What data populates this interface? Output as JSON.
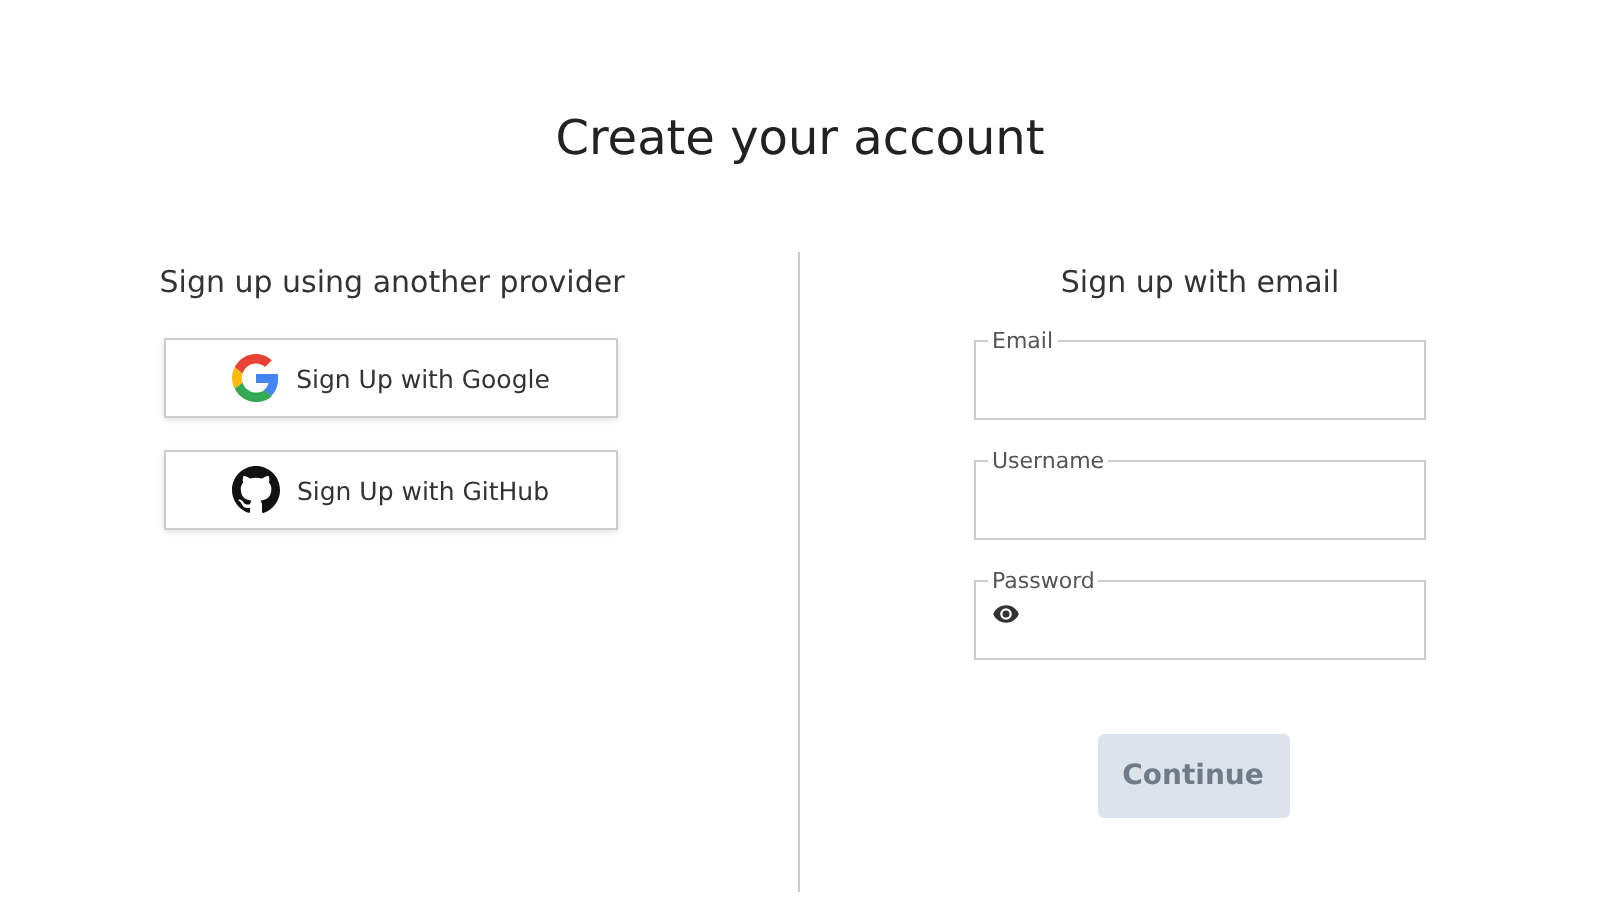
{
  "title": "Create your account",
  "providers": {
    "heading": "Sign up using another provider",
    "buttons": [
      {
        "kind": "google",
        "label": "Sign Up with Google"
      },
      {
        "kind": "github",
        "label": "Sign Up with GitHub"
      }
    ]
  },
  "email_form": {
    "heading": "Sign up with email",
    "fields": [
      {
        "label": "Email",
        "kind": "text"
      },
      {
        "label": "Username",
        "kind": "text"
      },
      {
        "label": "Password",
        "kind": "password"
      }
    ],
    "submit": {
      "label": "Continue",
      "disabled": true
    }
  }
}
